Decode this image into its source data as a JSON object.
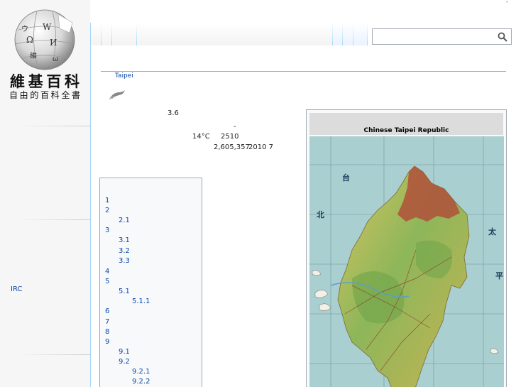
{
  "header": {
    "top_mark": "`",
    "search": {
      "placeholder": "",
      "value": ""
    }
  },
  "sidebar": {
    "logo": {
      "title": "維基百科",
      "tagline": "自由的百科全書"
    },
    "links": [
      {
        "label": "IRC"
      }
    ]
  },
  "article": {
    "subtitle_link": "Taipei",
    "lead": {
      "line1": "3.6",
      "line2": "-",
      "line3a": "14°C",
      "line3b": "2510",
      "line4a": "2,605,357",
      "line4b": "2010 7"
    }
  },
  "toc": {
    "items": [
      {
        "number": "1",
        "level": 1
      },
      {
        "number": "2",
        "level": 1
      },
      {
        "number": "2.1",
        "level": 2
      },
      {
        "number": "3",
        "level": 1
      },
      {
        "number": "3.1",
        "level": 2
      },
      {
        "number": "3.2",
        "level": 2
      },
      {
        "number": "3.3",
        "level": 2
      },
      {
        "number": "4",
        "level": 1
      },
      {
        "number": "5",
        "level": 1
      },
      {
        "number": "5.1",
        "level": 2
      },
      {
        "number": "5.1.1",
        "level": 3
      },
      {
        "number": "6",
        "level": 1
      },
      {
        "number": "7",
        "level": 1
      },
      {
        "number": "8",
        "level": 1
      },
      {
        "number": "9",
        "level": 1
      },
      {
        "number": "9.1",
        "level": 2
      },
      {
        "number": "9.2",
        "level": 2
      },
      {
        "number": "9.2.1",
        "level": 3
      },
      {
        "number": "9.2.2",
        "level": 3
      }
    ]
  },
  "infobox": {
    "title": "Chinese Taipei Republic",
    "map_labels": [
      "台",
      "北",
      "太",
      "平"
    ]
  },
  "colors": {
    "link": "#0645ad",
    "sea": "#a9cfd0",
    "land_green": "#8db65a",
    "land_yellow": "#d9c560",
    "mountain_red": "#b0503a"
  }
}
